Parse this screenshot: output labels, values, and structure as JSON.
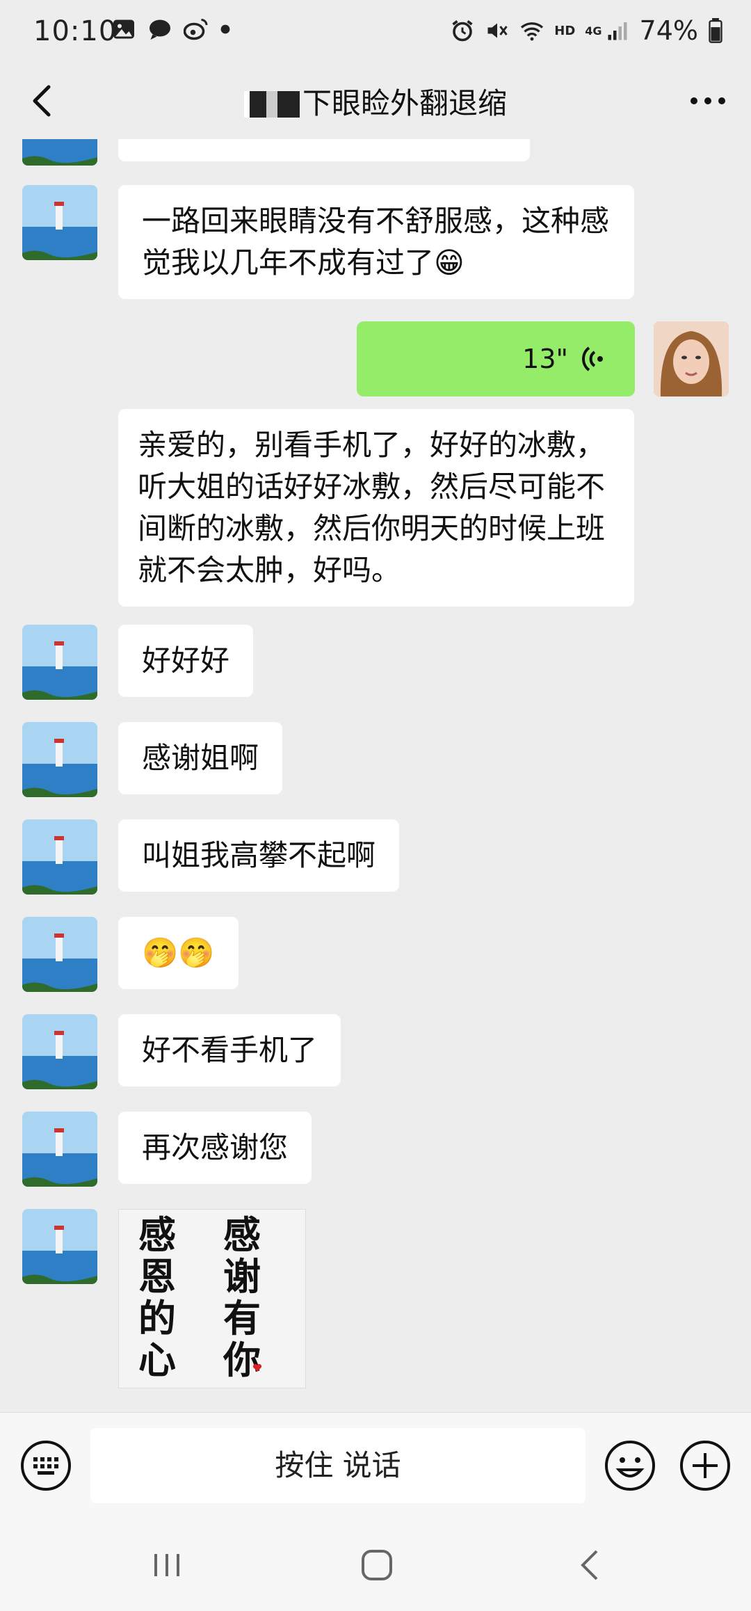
{
  "status": {
    "time": "10:10",
    "battery": "74%",
    "network": "4G",
    "hd": "HD"
  },
  "header": {
    "title": "下眼睑外翻退缩"
  },
  "messages": [
    {
      "side": "left",
      "text": "一路回来眼睛没有不舒服感，这种感觉我以几年不成有过了😁"
    },
    {
      "side": "right",
      "type": "voice",
      "duration": "13\""
    },
    {
      "side": "left",
      "text": "亲爱的，别看手机了，好好的冰敷，听大姐的话好好冰敷，然后尽可能不间断的冰敷，然后你明天的时候上班就不会太肿，好吗。"
    },
    {
      "side": "left",
      "text": "好好好"
    },
    {
      "side": "left",
      "text": "感谢姐啊"
    },
    {
      "side": "left",
      "text": "叫姐我高攀不起啊"
    },
    {
      "side": "left",
      "text": "🤭🤭"
    },
    {
      "side": "left",
      "text": "好不看手机了"
    },
    {
      "side": "left",
      "text": "再次感谢您"
    },
    {
      "side": "left",
      "type": "sticker",
      "lines_left": [
        "感",
        "恩",
        "的",
        "心"
      ],
      "lines_right": [
        "感",
        "谢",
        "有",
        "你"
      ]
    }
  ],
  "input": {
    "talk_label": "按住 说话"
  },
  "icons": {
    "back": "back-arrow-icon",
    "more": "more-dots-icon",
    "keyboard": "keyboard-icon",
    "emoji": "emoji-icon",
    "plus": "plus-icon"
  }
}
